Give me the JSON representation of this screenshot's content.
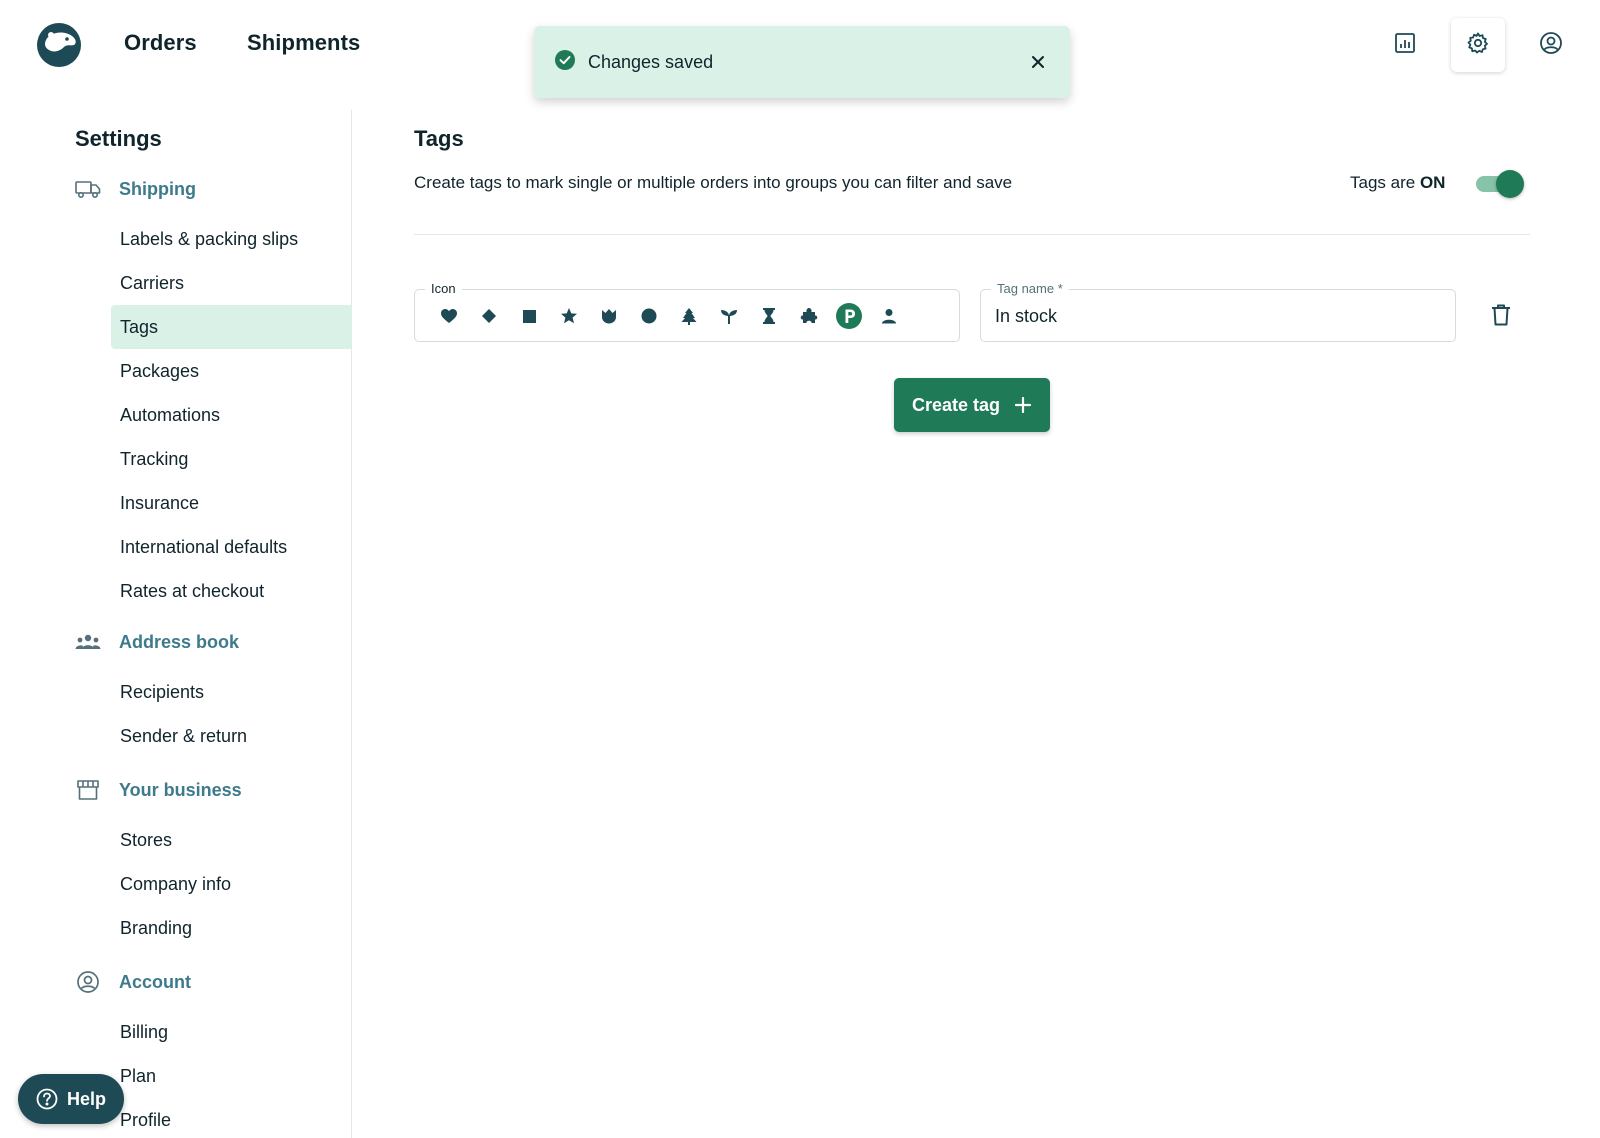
{
  "topbar": {
    "nav": [
      {
        "label": "Orders"
      },
      {
        "label": "Shipments"
      }
    ],
    "icons": [
      "reports-icon",
      "settings-icon",
      "account-icon"
    ]
  },
  "toast": {
    "message": "Changes saved",
    "icon": "check-circle-icon"
  },
  "sidebar": {
    "title": "Settings",
    "groups": [
      {
        "label": "Shipping",
        "icon": "truck-icon",
        "items": [
          "Labels & packing slips",
          "Carriers",
          "Tags",
          "Packages",
          "Automations",
          "Tracking",
          "Insurance",
          "International defaults",
          "Rates at checkout"
        ]
      },
      {
        "label": "Address book",
        "icon": "people-icon",
        "items": [
          "Recipients",
          "Sender & return"
        ]
      },
      {
        "label": "Your business",
        "icon": "storefront-icon",
        "items": [
          "Stores",
          "Company info",
          "Branding"
        ]
      },
      {
        "label": "Account",
        "icon": "user-circle-icon",
        "items": [
          "Billing",
          "Plan",
          "Profile"
        ]
      }
    ],
    "active_item": "Tags"
  },
  "main": {
    "title": "Tags",
    "description": "Create tags to mark single or multiple orders into groups you can filter and save",
    "toggle_prefix": "Tags are",
    "toggle_state": "ON",
    "toggle_on": true,
    "icon_field_label": "Icon",
    "icon_options": [
      "heart-icon",
      "diamond-icon",
      "square-icon",
      "star-icon",
      "tulip-icon",
      "circle-icon",
      "tree-icon",
      "sprout-icon",
      "hourglass-icon",
      "puzzle-icon",
      "parking-icon",
      "person-icon"
    ],
    "selected_icon": "parking-icon",
    "name_field_label": "Tag name *",
    "name_value": "In stock",
    "create_button": "Create tag"
  },
  "help": {
    "label": "Help"
  },
  "colors": {
    "accent": "#1f7a58",
    "accent_light": "#d9f1e6",
    "group_label": "#3d7a8c",
    "icon_dark": "#1d4a55"
  }
}
